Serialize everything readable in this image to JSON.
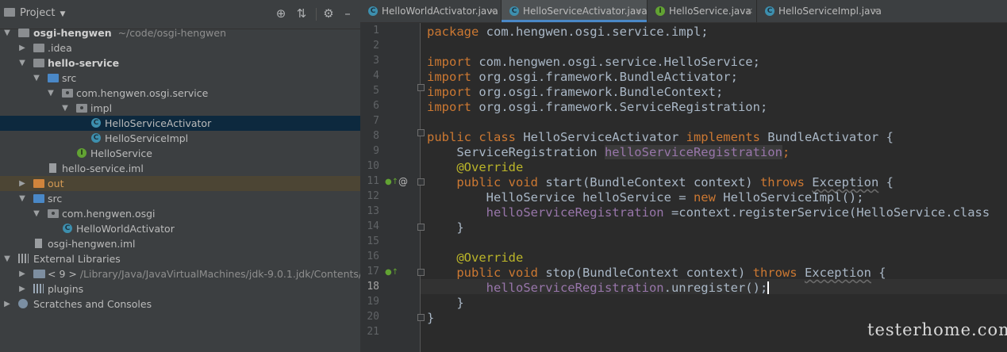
{
  "project_panel": {
    "title": "Project",
    "toolbar_icons": [
      "locate-icon",
      "collapse-icon",
      "gear-icon",
      "hide-icon"
    ]
  },
  "tree": {
    "root_name": "osgi-hengwen",
    "root_path": "~/code/osgi-hengwen",
    "idea": ".idea",
    "hello_service": "hello-service",
    "src": "src",
    "pkg_service": "com.hengwen.osgi.service",
    "impl": "impl",
    "activator": "HelloServiceActivator",
    "impl_class": "HelloServiceImpl",
    "iface": "HelloService",
    "hello_iml": "hello-service.iml",
    "out": "out",
    "src2": "src",
    "pkg_osgi": "com.hengwen.osgi",
    "world_activator": "HelloWorldActivator",
    "root_iml": "osgi-hengwen.iml",
    "ext_libs": "External Libraries",
    "jdk_name": "< 9 >",
    "jdk_path": "/Library/Java/JavaVirtualMachines/jdk-9.0.1.jdk/Contents/",
    "plugins": "plugins",
    "scratches": "Scratches and Consoles"
  },
  "tabs": [
    {
      "label": "HelloWorldActivator.java",
      "icon": "class-icon"
    },
    {
      "label": "HelloServiceActivator.java",
      "icon": "class-icon",
      "active": true
    },
    {
      "label": "HelloService.java",
      "icon": "interface-icon"
    },
    {
      "label": "HelloServiceImpl.java",
      "icon": "class-icon"
    }
  ],
  "tab_close": "×",
  "code": {
    "l1_kw": "package",
    "l1_rest": " com.hengwen.osgi.service.impl;",
    "l3_kw": "import",
    "l3_rest": " com.hengwen.osgi.service.HelloService;",
    "l4_kw": "import",
    "l4_rest": " org.osgi.framework.BundleActivator;",
    "l5_kw": "import",
    "l5_rest": " org.osgi.framework.BundleContext;",
    "l6_kw": "import",
    "l6_rest": " org.osgi.framework.ServiceRegistration;",
    "l8_kw1": "public class",
    "l8_name": " HelloServiceActivator ",
    "l8_kw2": "implements",
    "l8_rest": " BundleActivator {",
    "l9_type": "    ServiceRegistration ",
    "l9_field": "helloServiceRegistration",
    "l9_end": ";",
    "l10_ann": "    @Override",
    "l11_kw": "    public void",
    "l11_a": " start(BundleContext context) ",
    "l11_throws": "throws",
    "l11_sp": " ",
    "l11_exc": "Exception",
    "l11_end": " {",
    "l12_a": "        HelloService helloService = ",
    "l12_new": "new",
    "l12_b": " HelloServiceImpl();",
    "l13_field": "        helloServiceRegistration",
    "l13_rest": " =context.registerService(HelloService.class",
    "l14": "    }",
    "l16_ann": "    @Override",
    "l17_kw": "    public void",
    "l17_a": " stop(BundleContext context) ",
    "l17_throws": "throws",
    "l17_sp": " ",
    "l17_exc": "Exception",
    "l17_end": " {",
    "l18_field": "        helloServiceRegistration",
    "l18_rest": ".unregister();",
    "l19": "    }",
    "l20": "}"
  },
  "line_numbers": [
    "1",
    "2",
    "3",
    "4",
    "5",
    "6",
    "7",
    "8",
    "9",
    "10",
    "11",
    "12",
    "13",
    "14",
    "15",
    "16",
    "17",
    "18",
    "19",
    "20",
    "21"
  ],
  "current_line": 18,
  "watermark": "testerhome.com"
}
